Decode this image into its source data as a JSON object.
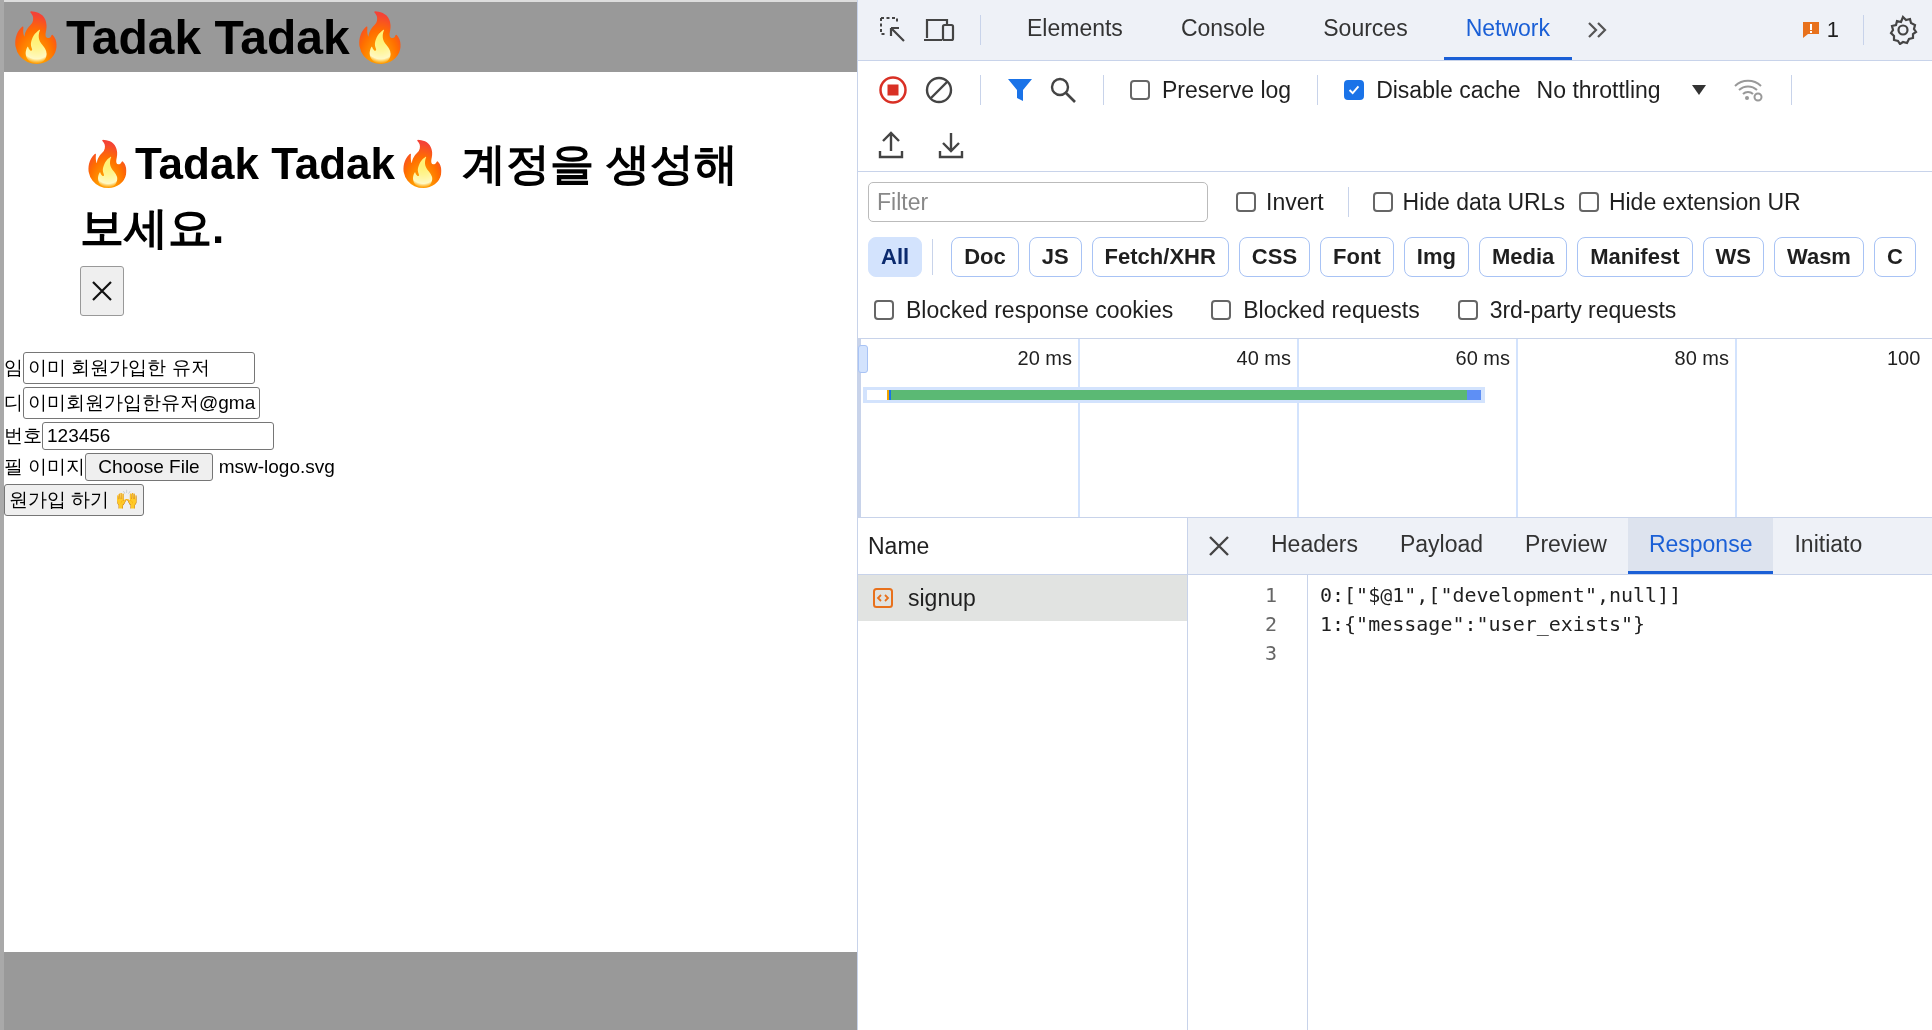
{
  "page": {
    "header_title": "🔥Tadak Tadak🔥",
    "heading": "🔥Tadak Tadak🔥 계정을 생성해 보세요.",
    "fields": [
      {
        "kind": "text",
        "label": "임",
        "value": "이미 회원가입한 유저"
      },
      {
        "kind": "text",
        "label": "디",
        "value": "이미회원가입한유저@gma"
      },
      {
        "kind": "text",
        "label": "번호",
        "value": "123456"
      },
      {
        "kind": "file",
        "label": "필 이미지",
        "button": "Choose File",
        "value": "msw-logo.svg"
      }
    ],
    "submit": "원가입 하기 🙌"
  },
  "devtools": {
    "tabs": [
      {
        "label": "Elements",
        "selected": false
      },
      {
        "label": "Console",
        "selected": false
      },
      {
        "label": "Sources",
        "selected": false
      },
      {
        "label": "Network",
        "selected": true
      }
    ],
    "issues_count": "1",
    "toolbar_checkboxes": [
      {
        "label": "Preserve log",
        "checked": false
      },
      {
        "label": "Disable cache",
        "checked": true
      }
    ],
    "throttling": "No throttling",
    "filter": {
      "placeholder": "Filter"
    },
    "filter_checkboxes": [
      {
        "label": "Invert",
        "checked": false
      },
      {
        "label": "Hide data URLs",
        "checked": false
      },
      {
        "label": "Hide extension UR",
        "checked": false
      }
    ],
    "type_filters": [
      {
        "label": "All",
        "selected": true
      },
      {
        "label": "Doc",
        "selected": false
      },
      {
        "label": "JS",
        "selected": false
      },
      {
        "label": "Fetch/XHR",
        "selected": false
      },
      {
        "label": "CSS",
        "selected": false
      },
      {
        "label": "Font",
        "selected": false
      },
      {
        "label": "Img",
        "selected": false
      },
      {
        "label": "Media",
        "selected": false
      },
      {
        "label": "Manifest",
        "selected": false
      },
      {
        "label": "WS",
        "selected": false
      },
      {
        "label": "Wasm",
        "selected": false
      },
      {
        "label": "C",
        "selected": false
      }
    ],
    "request_checkboxes": [
      {
        "label": "Blocked response cookies",
        "checked": false
      },
      {
        "label": "Blocked requests",
        "checked": false
      },
      {
        "label": "3rd-party requests",
        "checked": false
      }
    ],
    "timeline_ticks": [
      "20 ms",
      "40 ms",
      "60 ms",
      "80 ms",
      "100"
    ],
    "name_column": "Name",
    "requests": [
      {
        "name": "signup",
        "selected": true
      }
    ],
    "detail_tabs": [
      {
        "label": "Headers",
        "selected": false
      },
      {
        "label": "Payload",
        "selected": false
      },
      {
        "label": "Preview",
        "selected": false
      },
      {
        "label": "Response",
        "selected": true
      },
      {
        "label": "Initiato",
        "selected": false
      }
    ],
    "response_lines": [
      {
        "number": "1",
        "text": "0:[\"$@1\",[\"development\",null]]"
      },
      {
        "number": "2",
        "text": "1:{\"message\":\"user_exists\"}"
      },
      {
        "number": "3"
      }
    ]
  }
}
